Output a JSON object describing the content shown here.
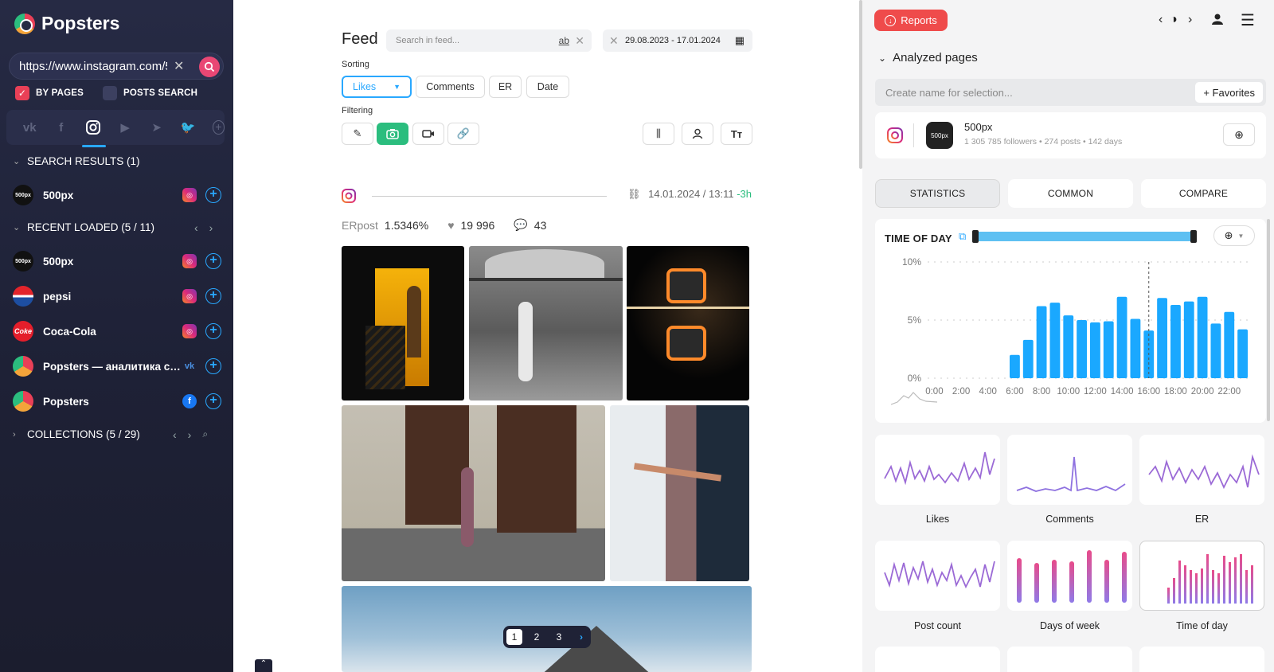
{
  "app": {
    "name": "Popsters"
  },
  "sidebar": {
    "url_value": "https://www.instagram.com/50",
    "checks": [
      {
        "label": "BY PAGES",
        "checked": true
      },
      {
        "label": "POSTS SEARCH",
        "checked": false
      }
    ],
    "networks": [
      "vk-icon",
      "facebook-icon",
      "instagram-icon",
      "youtube-icon",
      "telegram-icon",
      "twitter-icon"
    ],
    "search_results": {
      "title": "SEARCH RESULTS (1)",
      "items": [
        {
          "name": "500px",
          "source": "instagram"
        }
      ]
    },
    "recent": {
      "title": "RECENT LOADED (5 / 11)",
      "items": [
        {
          "name": "500px",
          "source": "instagram"
        },
        {
          "name": "pepsi",
          "source": "instagram"
        },
        {
          "name": "Coca-Cola",
          "source": "instagram"
        },
        {
          "name": "Popsters — аналитика со...",
          "source": "vk"
        },
        {
          "name": "Popsters",
          "source": "facebook"
        }
      ]
    },
    "collections": {
      "title": "COLLECTIONS (5 / 29)"
    }
  },
  "feed": {
    "title": "Feed",
    "search_placeholder": "Search in feed...",
    "search_ab": "ab",
    "date_range": "29.08.2023 - 17.01.2024",
    "sorting_label": "Sorting",
    "sorting": [
      "Likes",
      "Comments",
      "ER",
      "Date"
    ],
    "filtering_label": "Filtering",
    "post": {
      "datetime": "14.01.2024 / 13:11",
      "relative": "-3h",
      "er_label": "ERpost",
      "er_value": "1.5346%",
      "likes": "19 996",
      "comments": "43"
    },
    "pages": [
      "1",
      "2",
      "3"
    ]
  },
  "right": {
    "reports_label": "Reports",
    "analyzed_title": "Analyzed pages",
    "selection_placeholder": "Create name for selection...",
    "favorites_label": "+ Favorites",
    "page": {
      "name": "500px",
      "meta": "1 305 785 followers • 274 posts • 142 days",
      "avatar": "500px"
    },
    "tabs": [
      "STATISTICS",
      "COMMON",
      "COMPARE"
    ],
    "mini_charts": [
      "Likes",
      "Comments",
      "ER",
      "Post count",
      "Days of week",
      "Time of day"
    ]
  },
  "chart_data": {
    "type": "bar",
    "title": "TIME OF DAY",
    "categories": [
      "0:00",
      "1:00",
      "2:00",
      "3:00",
      "4:00",
      "5:00",
      "6:00",
      "7:00",
      "8:00",
      "9:00",
      "10:00",
      "11:00",
      "12:00",
      "13:00",
      "14:00",
      "15:00",
      "16:00",
      "17:00",
      "18:00",
      "19:00",
      "20:00",
      "21:00",
      "22:00",
      "23:00"
    ],
    "x_tick_labels": [
      "0:00",
      "2:00",
      "4:00",
      "6:00",
      "8:00",
      "10:00",
      "12:00",
      "14:00",
      "16:00",
      "18:00",
      "20:00",
      "22:00"
    ],
    "values": [
      0,
      0,
      0,
      0,
      0,
      0,
      2.0,
      3.3,
      6.2,
      6.5,
      5.4,
      5.0,
      4.8,
      4.9,
      7.0,
      5.1,
      4.1,
      6.9,
      6.3,
      6.6,
      7.0,
      4.7,
      5.7,
      4.2
    ],
    "ylim": [
      0,
      10
    ],
    "y_ticks": [
      "0%",
      "5%",
      "10%"
    ],
    "marker_at": "16:00",
    "grid": true,
    "bar_color": "#1aa8ff"
  },
  "colors": {
    "accent": "#29a8ff",
    "green": "#2bbd7e",
    "red": "#ef4b4b",
    "sidebar": "#22253c"
  }
}
